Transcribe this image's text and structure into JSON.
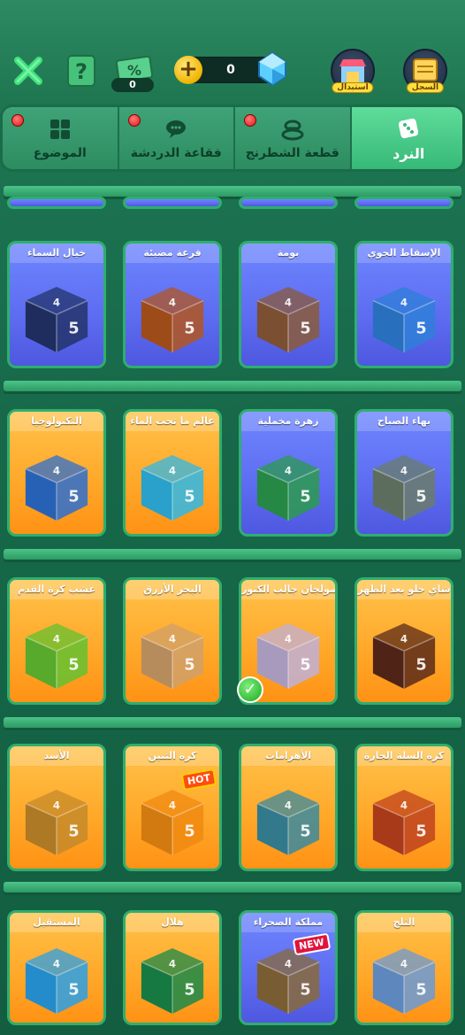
{
  "header": {
    "sale_badge_count": "0",
    "gems_count": "0",
    "swap_button_label": "استبدال",
    "history_button_label": "السجل",
    "icons": {
      "close": "close-x-icon",
      "help": "question-mark-icon",
      "sale": "percent-ticket-icon",
      "add_gems": "plus-coin-icon",
      "gem": "blue-diamond-icon"
    },
    "colors": {
      "accent_green": "#3fd98a",
      "close_green": "#3fe07a",
      "gem_blue": "#5ccfff",
      "coin_gold": "#f0b400"
    }
  },
  "tabs": [
    {
      "label": "الموضوع",
      "icon": "grid-squares-icon",
      "new_dot": true,
      "active": false
    },
    {
      "label": "فقاعة الدردشة",
      "icon": "chat-bubble-icon",
      "new_dot": true,
      "active": false
    },
    {
      "label": "قطعة الشطرنج",
      "icon": "chess-piece-icon",
      "new_dot": true,
      "active": false
    },
    {
      "label": "النرد",
      "icon": "dice-icon",
      "new_dot": false,
      "active": true
    }
  ],
  "grid": {
    "rows": [
      [
        {
          "title": "خيال السماء",
          "style": "blue",
          "dice_color": "#23346b"
        },
        {
          "title": "قرعة مضيئة",
          "style": "blue",
          "dice_color": "#b4561e"
        },
        {
          "title": "بومة",
          "style": "blue",
          "dice_color": "#8b5a3a"
        },
        {
          "title": "الإسقاط الجوي",
          "style": "blue",
          "dice_color": "#2e7fd8"
        }
      ],
      [
        {
          "title": "التكنولوجيا",
          "style": "orange",
          "dice_color": "#2d6fd0"
        },
        {
          "title": "عالم ما تحت الماء",
          "style": "orange",
          "dice_color": "#2fb8e8"
        },
        {
          "title": "زهرة مخملية",
          "style": "blue",
          "dice_color": "#2b9b4e"
        },
        {
          "title": "بهاء الصباح",
          "style": "blue",
          "dice_color": "#6a7d6a"
        }
      ],
      [
        {
          "title": "عشب كرة القدم",
          "style": "orange",
          "dice_color": "#63c231"
        },
        {
          "title": "البحر الأزرق",
          "style": "orange",
          "dice_color": "#d0a06a"
        },
        {
          "title": "صولجان جالب الكنوز",
          "style": "orange",
          "dice_color": "#c0b0d8",
          "selected": true
        },
        {
          "title": "شاي حلو بعد الظهر",
          "style": "orange",
          "dice_color": "#5a2a1a"
        }
      ],
      [
        {
          "title": "الأسد",
          "style": "orange",
          "dice_color": "#c58a2a"
        },
        {
          "title": "كرة التنين",
          "style": "orange",
          "dice_color": "#f08a12",
          "badge": "HOT"
        },
        {
          "title": "الأهرامات",
          "style": "orange",
          "dice_color": "#3a8aa0"
        },
        {
          "title": "كرة السلة الحارة",
          "style": "orange",
          "dice_color": "#c0421e"
        }
      ],
      [
        {
          "title": "المستقبل",
          "style": "orange",
          "dice_color": "#2aa0e8"
        },
        {
          "title": "هلال",
          "style": "orange",
          "dice_color": "#1a8a4a"
        },
        {
          "title": "مملكة الصحراء",
          "style": "blue",
          "dice_color": "#8a6a3a",
          "badge": "NEW"
        },
        {
          "title": "الثلج",
          "style": "orange",
          "dice_color": "#6a9ad8"
        }
      ]
    ]
  }
}
